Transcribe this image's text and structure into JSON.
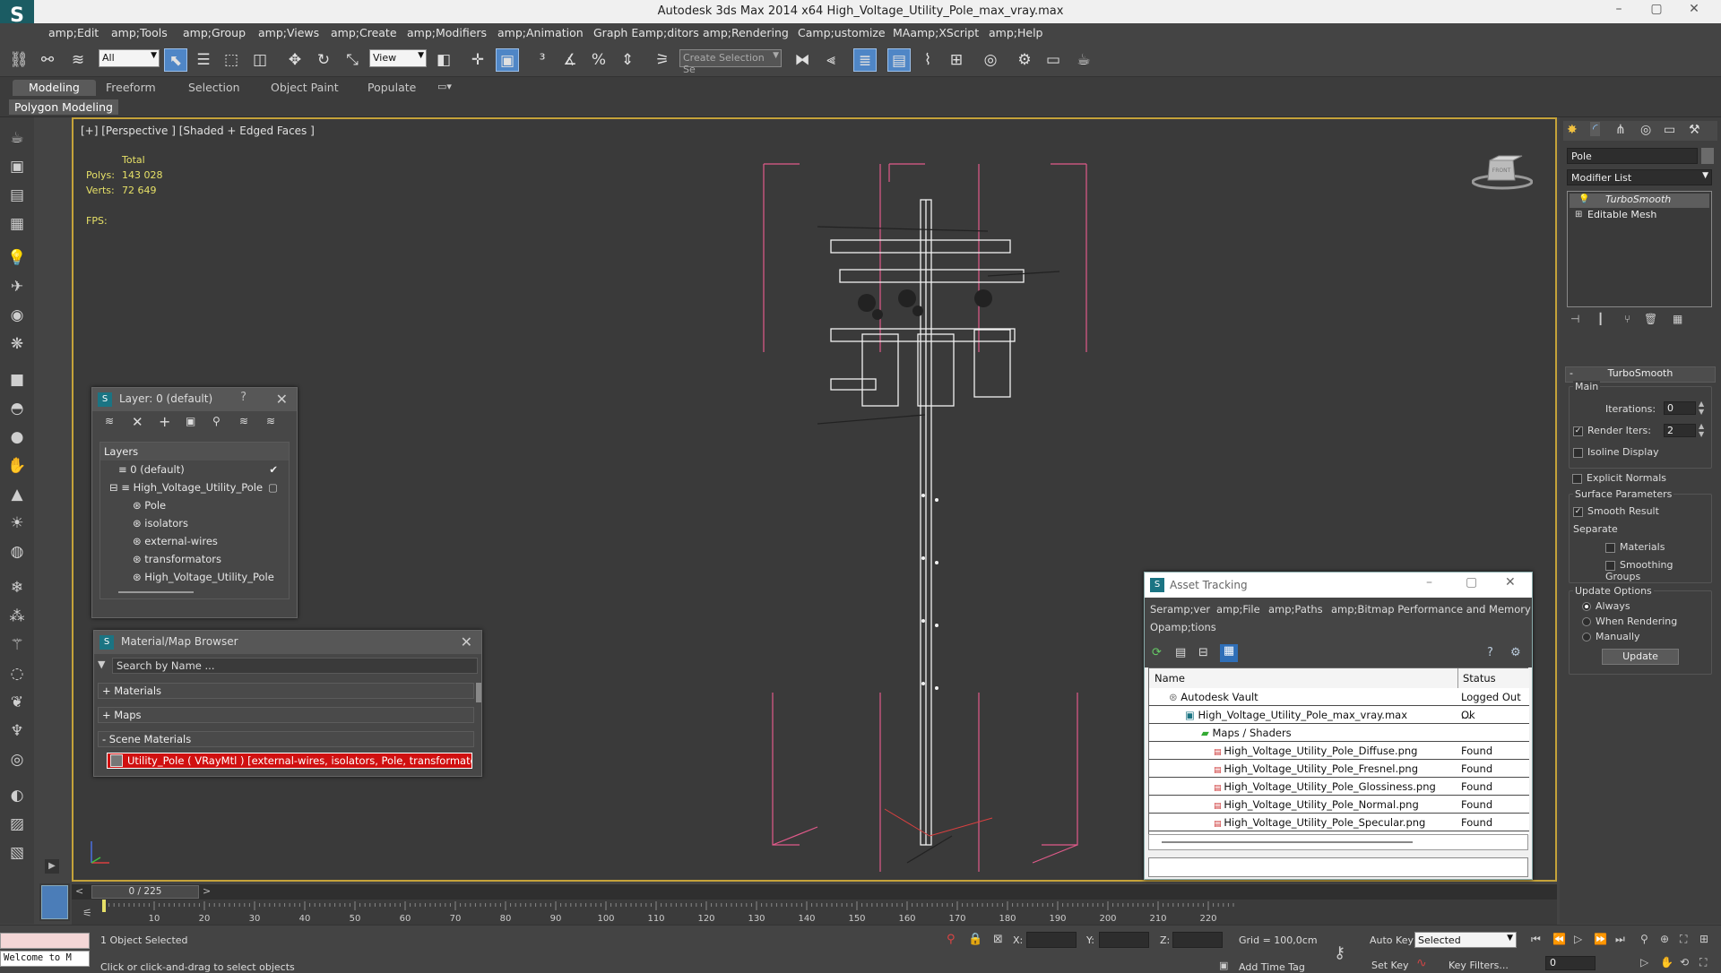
{
  "window": {
    "title": "Autodesk 3ds Max  2014 x64    High_Voltage_Utility_Pole_max_vray.max",
    "minimize": "–",
    "maximize": "▢",
    "close": "✕"
  },
  "menu": [
    "amp;Edit",
    "amp;Tools",
    "amp;Group",
    "amp;Views",
    "amp;Create",
    "amp;Modifiers",
    "amp;Animation",
    "Graph Eamp;ditors",
    "amp;Rendering",
    "Camp;ustomize",
    "MAamp;XScript",
    "amp;Help"
  ],
  "toolbar": {
    "filter": "All",
    "ref_coord": "View",
    "selection_set": "Create Selection Se"
  },
  "ribbon": {
    "tabs": [
      "Modeling",
      "Freeform",
      "Selection",
      "Object Paint",
      "Populate"
    ],
    "sub_label": "Polygon Modeling"
  },
  "viewport": {
    "label": "[+] [Perspective ] [Shaded + Edged Faces ]",
    "stats": {
      "total_label": "Total",
      "polys_label": "Polys:",
      "polys": "143 028",
      "verts_label": "Verts:",
      "verts": "72 649",
      "fps_label": "FPS:"
    },
    "viewcube_label": "FRONT"
  },
  "command_panel": {
    "object_name": "Pole",
    "modifier_list": "Modifier List",
    "stack": [
      "TurboSmooth",
      "Editable Mesh"
    ],
    "turbosmooth": {
      "title": "TurboSmooth",
      "main": "Main",
      "iterations_label": "Iterations:",
      "iterations": "0",
      "render_iters_label": "Render Iters:",
      "render_iters": "2",
      "isoline": "Isoline Display",
      "explicit_normals": "Explicit Normals",
      "surface_params": "Surface Parameters",
      "smooth_result": "Smooth Result",
      "separate": "Separate",
      "materials": "Materials",
      "smoothing_groups": "Smoothing Groups",
      "update_options": "Update Options",
      "always": "Always",
      "when_rendering": "When Rendering",
      "manually": "Manually",
      "update_btn": "Update"
    }
  },
  "layer_panel": {
    "title": "Layer: 0 (default)",
    "help": "?",
    "header": "Layers",
    "rows": [
      {
        "name": "0 (default)",
        "indent": 0
      },
      {
        "name": "High_Voltage_Utility_Pole",
        "indent": 0
      },
      {
        "name": "Pole",
        "indent": 1
      },
      {
        "name": "isolators",
        "indent": 1
      },
      {
        "name": "external-wires",
        "indent": 1
      },
      {
        "name": "transformators",
        "indent": 1
      },
      {
        "name": "High_Voltage_Utility_Pole",
        "indent": 1
      }
    ]
  },
  "material_browser": {
    "title": "Material/Map Browser",
    "search_placeholder": "Search by Name ...",
    "groups": [
      "+ Materials",
      "+ Maps",
      "- Scene Materials"
    ],
    "scene_item": "Utility_Pole  ( VRayMtl ) [external-wires, isolators, Pole, transformators]"
  },
  "asset_tracking": {
    "title": "Asset Tracking",
    "menu": [
      "Seramp;ver",
      "amp;File",
      "amp;Paths",
      "amp;Bitmap Performance and Memory",
      "Opamp;tions"
    ],
    "col_name": "Name",
    "col_status": "Status",
    "rows": [
      {
        "name": "Autodesk Vault",
        "status": "Logged Out ...",
        "indent": 1
      },
      {
        "name": "High_Voltage_Utility_Pole_max_vray.max",
        "status": "Ok",
        "indent": 2
      },
      {
        "name": "Maps / Shaders",
        "status": "",
        "indent": 3
      },
      {
        "name": "High_Voltage_Utility_Pole_Diffuse.png",
        "status": "Found",
        "indent": 4
      },
      {
        "name": "High_Voltage_Utility_Pole_Fresnel.png",
        "status": "Found",
        "indent": 4
      },
      {
        "name": "High_Voltage_Utility_Pole_Glossiness.png",
        "status": "Found",
        "indent": 4
      },
      {
        "name": "High_Voltage_Utility_Pole_Normal.png",
        "status": "Found",
        "indent": 4
      },
      {
        "name": "High_Voltage_Utility_Pole_Specular.png",
        "status": "Found",
        "indent": 4
      }
    ]
  },
  "timeline": {
    "frame": "0 / 225",
    "ticks": [
      "10",
      "20",
      "30",
      "40",
      "50",
      "60",
      "70",
      "80",
      "90",
      "100",
      "110",
      "120",
      "130",
      "140",
      "150",
      "160",
      "170",
      "180",
      "190",
      "200",
      "210",
      "220"
    ]
  },
  "status": {
    "welcome": "Welcome to M",
    "selected": "1 Object Selected",
    "hint": "Click or click-and-drag to select objects",
    "x_label": "X:",
    "y_label": "Y:",
    "z_label": "Z:",
    "grid": "Grid = 100,0cm",
    "add_time_tag": "Add Time Tag",
    "auto_key": "Auto Key",
    "set_key": "Set Key",
    "key_mode": "Selected",
    "key_filters": "Key Filters...",
    "frame_field": "0"
  },
  "colors": {
    "viewport_border": "#c5a33a",
    "stats": "#e6e067",
    "accent": "#4f86c6",
    "material_swatch": "#d01010"
  }
}
